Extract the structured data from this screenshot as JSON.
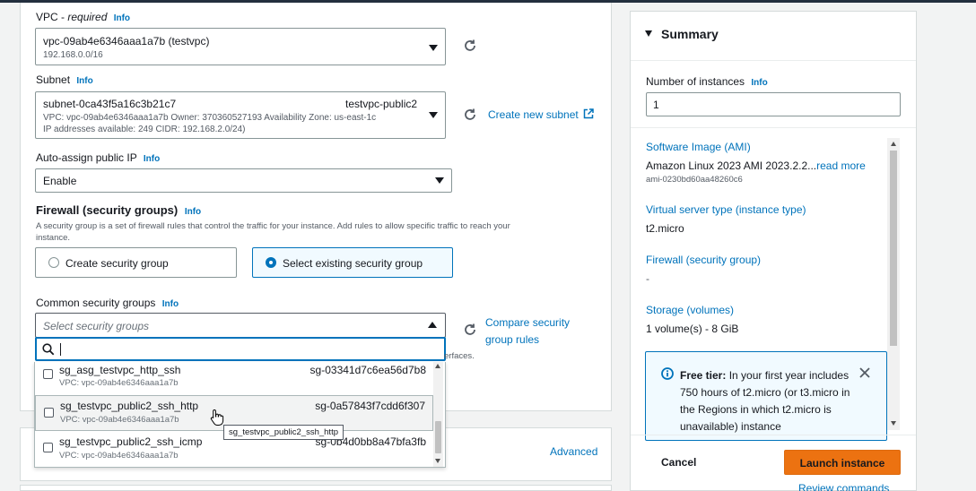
{
  "network": {
    "vpc": {
      "label": "VPC - ",
      "label_required": "required",
      "info": "Info",
      "value": "vpc-09ab4e6346aaa1a7b (testvpc)",
      "cidr": "192.168.0.0/16"
    },
    "subnet": {
      "label": "Subnet",
      "info": "Info",
      "id": "subnet-0ca43f5a16c3b21c7",
      "name": "testvpc-public2",
      "detail1": "VPC: vpc-09ab4e6346aaa1a7b    Owner: 370360527193    Availability Zone: us-east-1c",
      "detail2": "IP addresses available: 249    CIDR: 192.168.2.0/24)",
      "create_link": "Create new subnet"
    },
    "public_ip": {
      "label": "Auto-assign public IP",
      "info": "Info",
      "value": "Enable"
    },
    "firewall": {
      "title": "Firewall (security groups)",
      "info": "Info",
      "desc1": "A security group is a set of firewall rules that control the traffic for your instance. Add rules to allow specific traffic to reach your",
      "desc2": "instance.",
      "option_create": "Create security group",
      "option_select": "Select existing security group"
    },
    "common_sg": {
      "label": "Common security groups",
      "info": "Info",
      "placeholder": "Select security groups",
      "search_value": "",
      "compare_link1": "Compare security",
      "compare_link2": "group rules",
      "hidden_text": "erfaces."
    },
    "options": [
      {
        "name": "sg_asg_testvpc_http_ssh",
        "vpc": "VPC: vpc-09ab4e6346aaa1a7b",
        "id": "sg-03341d7c6ea56d7b8"
      },
      {
        "name": "sg_testvpc_public2_ssh_http",
        "vpc": "VPC: vpc-09ab4e6346aaa1a7b",
        "id": "sg-0a57843f7cdd6f307"
      },
      {
        "name": "sg_testvpc_public2_ssh_icmp",
        "vpc": "VPC: vpc-09ab4e6346aaa1a7b",
        "id": "sg-0b4d0bb8a47bfa3fb"
      }
    ],
    "tooltip": "sg_testvpc_public2_ssh_http",
    "advanced": "Advanced"
  },
  "summary": {
    "title": "Summary",
    "instances_label": "Number of instances",
    "instances_info": "Info",
    "instances_value": "1",
    "ami_label": "Software Image (AMI)",
    "ami_value": "Amazon Linux 2023 AMI 2023.2.2...",
    "ami_read_more": "read more",
    "ami_id": "ami-0230bd60aa48260c6",
    "type_label": "Virtual server type (instance type)",
    "type_value": "t2.micro",
    "firewall_label": "Firewall (security group)",
    "firewall_value": "-",
    "storage_label": "Storage (volumes)",
    "storage_value": "1 volume(s) - 8 GiB",
    "free_tier_bold": "Free tier:",
    "free_tier_text": " In your first year includes 750 hours of t2.micro (or t3.micro in the Regions in which t2.micro is unavailable) instance",
    "cancel": "Cancel",
    "launch": "Launch instance",
    "review": "Review commands"
  },
  "colors": {
    "link": "#0073bb",
    "launch": "#ec7211",
    "selected_bg": "#f1faff"
  }
}
